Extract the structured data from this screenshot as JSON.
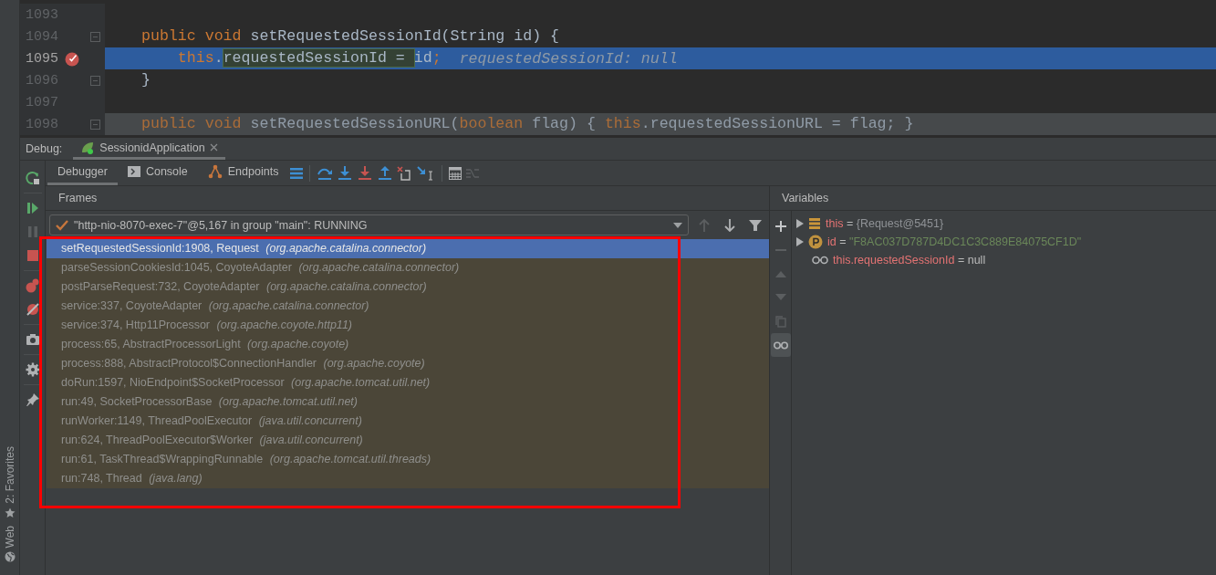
{
  "editor": {
    "lines": [
      {
        "number": "1093",
        "fold": false,
        "breakpoint": false,
        "current": false,
        "collapsed": false
      },
      {
        "number": "1094",
        "tokens": [
          {
            "kind": "keyword",
            "text": "public void "
          },
          {
            "kind": "plain",
            "text": "setRequestedSessionId(String id) {"
          }
        ],
        "fold": true,
        "breakpoint": false,
        "current": false,
        "collapsed": false
      },
      {
        "number": "1095",
        "tokens": [
          {
            "kind": "keyword",
            "text": "    this"
          },
          {
            "kind": "plain",
            "text": "."
          },
          {
            "kind": "match",
            "text": "requestedSessionId = "
          },
          {
            "kind": "plain",
            "text": "id"
          },
          {
            "kind": "keyword",
            "text": ";"
          }
        ],
        "hint": "requestedSessionId: null",
        "fold": false,
        "breakpoint": true,
        "current": true,
        "collapsed": false
      },
      {
        "number": "1096",
        "tokens": [
          {
            "kind": "plain",
            "text": "}"
          }
        ],
        "fold": true,
        "breakpoint": false,
        "current": false,
        "collapsed": false
      },
      {
        "number": "1097",
        "fold": false,
        "breakpoint": false,
        "current": false,
        "collapsed": false
      },
      {
        "number": "1098",
        "tokens": [
          {
            "kind": "keyword",
            "text": "public void "
          },
          {
            "kind": "plain",
            "text": "setRequestedSessionURL("
          },
          {
            "kind": "keyword",
            "text": "boolean "
          },
          {
            "kind": "plain",
            "text": "flag) { "
          },
          {
            "kind": "keyword",
            "text": "this"
          },
          {
            "kind": "plain",
            "text": ".requestedSessionURL = flag; }"
          }
        ],
        "fold": true,
        "breakpoint": false,
        "current": false,
        "collapsed": true
      }
    ]
  },
  "debug_header": {
    "label": "Debug:",
    "tabs": [
      {
        "label": "SessionidApplication",
        "selected": true
      }
    ]
  },
  "toolbar": {
    "tabs": [
      {
        "label": "Debugger",
        "selected": true
      },
      {
        "label": "Console",
        "selected": false
      },
      {
        "label": "Endpoints",
        "selected": false
      }
    ]
  },
  "frames": {
    "title": "Frames",
    "thread": "\"http-nio-8070-exec-7\"@5,167 in group \"main\": RUNNING",
    "items": [
      {
        "text": "setRequestedSessionId:1908, Request *(org.apache.catalina.connector)*",
        "selected": true
      },
      {
        "text": "parseSessionCookiesId:1045, CoyoteAdapter *(org.apache.catalina.connector)*",
        "selected": false
      },
      {
        "text": "postParseRequest:732, CoyoteAdapter *(org.apache.catalina.connector)*",
        "selected": false
      },
      {
        "text": "service:337, CoyoteAdapter *(org.apache.catalina.connector)*",
        "selected": false
      },
      {
        "text": "service:374, Http11Processor *(org.apache.coyote.http11)*",
        "selected": false
      },
      {
        "text": "process:65, AbstractProcessorLight *(org.apache.coyote)*",
        "selected": false
      },
      {
        "text": "process:888, AbstractProtocol$ConnectionHandler *(org.apache.coyote)*",
        "selected": false
      },
      {
        "text": "doRun:1597, NioEndpoint$SocketProcessor *(org.apache.tomcat.util.net)*",
        "selected": false
      },
      {
        "text": "run:49, SocketProcessorBase *(org.apache.tomcat.util.net)*",
        "selected": false
      },
      {
        "text": "runWorker:1149, ThreadPoolExecutor *(java.util.concurrent)*",
        "selected": false
      },
      {
        "text": "run:624, ThreadPoolExecutor$Worker *(java.util.concurrent)*",
        "selected": false
      },
      {
        "text": "run:61, TaskThread$WrappingRunnable *(org.apache.tomcat.util.threads)*",
        "selected": false
      },
      {
        "text": "run:748, Thread *(java.lang)*",
        "selected": false
      }
    ]
  },
  "variables": {
    "title": "Variables",
    "items": [
      {
        "kind": "object",
        "name": "this",
        "operator": "=",
        "value": "{Request@5451}",
        "expandable": true
      },
      {
        "kind": "param",
        "name": "id",
        "operator": "=",
        "value": "\"F8AC037D787D4DC1C3C889E84075CF1D\"",
        "expandable": true
      },
      {
        "kind": "watch",
        "name": "this.requestedSessionId",
        "operator": "=",
        "value": "null",
        "expandable": false
      }
    ]
  },
  "side_bar": [
    {
      "label": "2: Favorites",
      "kind": "star"
    },
    {
      "label": "Web",
      "kind": "globe"
    }
  ]
}
